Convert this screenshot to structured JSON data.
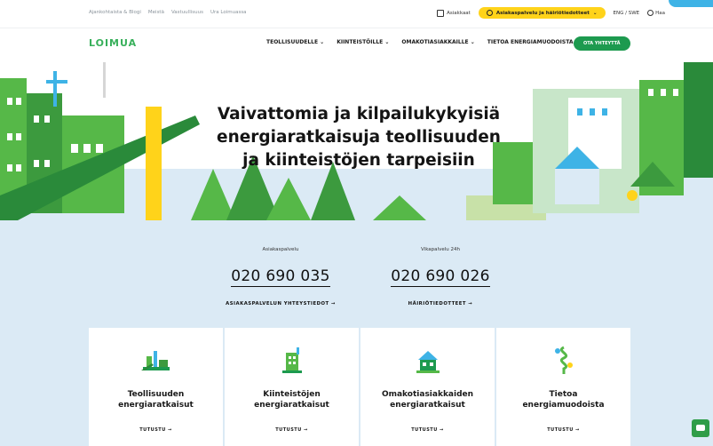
{
  "util": {
    "links": [
      "Ajankohtaista & Blogi",
      "Meistä",
      "Vastuullisuus",
      "Ura Loimuassa"
    ],
    "account_label": "Asiakkaat",
    "notice_label": "Asiakaspalvelu ja häiriötiedotteet",
    "language_label": "ENG / SWE",
    "search_label": "Haa"
  },
  "nav": {
    "logo": "LOIMUA",
    "menu": [
      "TEOLLISUUDELLE",
      "KIINTEISTÖILLE",
      "OMAKOTIASIAKKAILLE",
      "TIETOA ENERGIAMUODOISTA"
    ],
    "cta": "OTA YHTEYTTÄ"
  },
  "hero": {
    "title_line1": "Vaivattomia ja kilpailukykyisiä",
    "title_line2": "energiaratkaisuja teollisuuden",
    "title_line3": "ja kiinteistöjen tarpeisiin"
  },
  "service": {
    "customer": {
      "label": "Asiakaspalvelu",
      "phone": "020 690 035",
      "link": "ASIAKASPALVELUN YHTEYSTIEDOT →"
    },
    "fault": {
      "label": "Vikapalvelu 24h",
      "phone": "020 690 026",
      "link": "HÄIRIÖTIEDOTTEET →"
    }
  },
  "cards": [
    {
      "title_l1": "Teollisuuden",
      "title_l2": "energiaratkaisut",
      "link": "TUTUSTU →",
      "icon": "factory-icon"
    },
    {
      "title_l1": "Kiinteistöjen",
      "title_l2": "energiaratkaisut",
      "link": "TUTUSTU →",
      "icon": "building-icon"
    },
    {
      "title_l1": "Omakotiasiakkaiden",
      "title_l2": "energiaratkaisut",
      "link": "TUTUSTU →",
      "icon": "house-icon"
    },
    {
      "title_l1": "Tietoa",
      "title_l2": "energiamuodoista",
      "link": "TUTUSTU →",
      "icon": "energy-info-icon"
    }
  ],
  "colors": {
    "brand_green": "#38b05b",
    "accent_yellow": "#ffd31a",
    "cta_green": "#1d9a4f",
    "hero_sky": "#dbeaf5"
  }
}
